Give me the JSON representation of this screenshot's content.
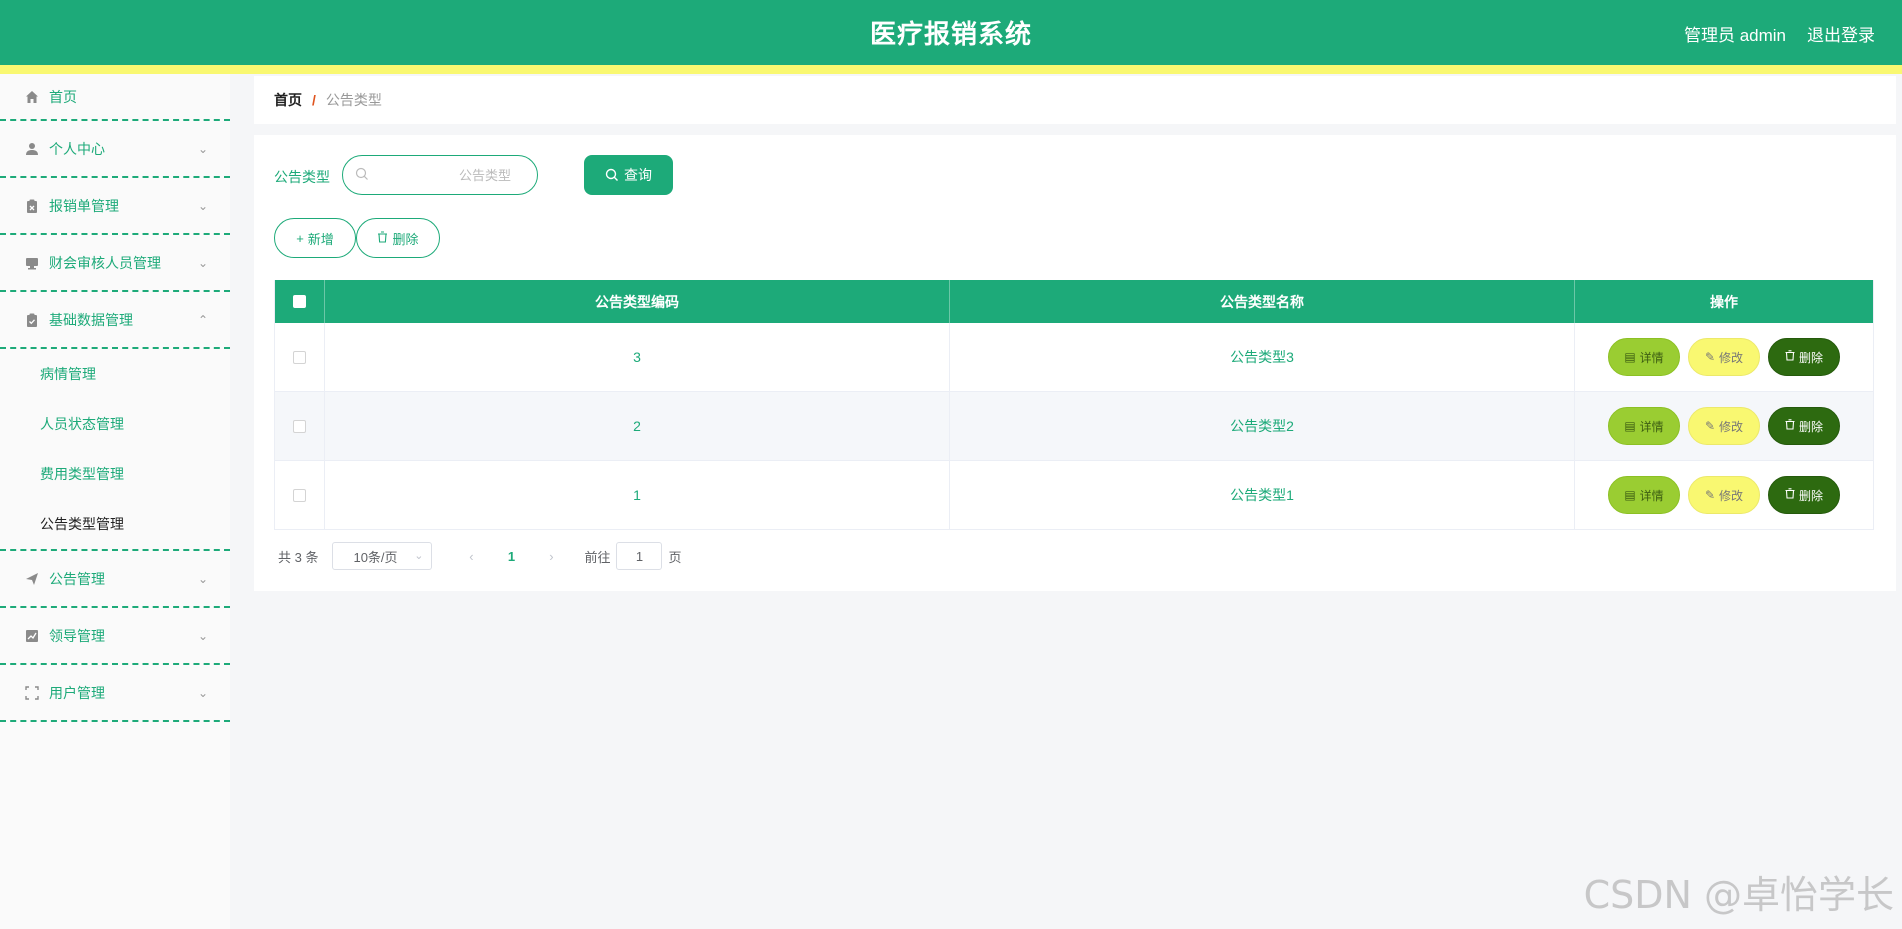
{
  "header": {
    "title": "医疗报销系统",
    "user": "管理员 admin",
    "logout": "退出登录"
  },
  "sidebar": {
    "items": [
      {
        "label": "首页",
        "icon": "home-icon"
      },
      {
        "label": "个人中心",
        "icon": "user-icon"
      },
      {
        "label": "报销单管理",
        "icon": "clipboard-x-icon"
      },
      {
        "label": "财会审核人员管理",
        "icon": "monitor-icon"
      },
      {
        "label": "基础数据管理",
        "icon": "clipboard-check-icon"
      },
      {
        "label": "公告管理",
        "icon": "send-icon"
      },
      {
        "label": "领导管理",
        "icon": "chart-icon"
      },
      {
        "label": "用户管理",
        "icon": "scan-icon"
      }
    ],
    "submenu": [
      {
        "label": "病情管理"
      },
      {
        "label": "人员状态管理"
      },
      {
        "label": "费用类型管理"
      },
      {
        "label": "公告类型管理"
      }
    ]
  },
  "breadcrumb": {
    "home": "首页",
    "separator": "/",
    "current": "公告类型"
  },
  "search": {
    "label": "公告类型",
    "placeholder": "公告类型",
    "button": "查询"
  },
  "actions": {
    "add": "新增",
    "delete": "删除"
  },
  "table": {
    "columns": [
      "公告类型编码",
      "公告类型名称",
      "操作"
    ],
    "rows": [
      {
        "code": "3",
        "name": "公告类型3"
      },
      {
        "code": "2",
        "name": "公告类型2"
      },
      {
        "code": "1",
        "name": "公告类型1"
      }
    ],
    "ops": {
      "detail": "详情",
      "edit": "修改",
      "delete": "删除"
    }
  },
  "pagination": {
    "total": "共 3 条",
    "page_size": "10条/页",
    "current_page": "1",
    "goto_label": "前往",
    "goto_value": "1",
    "page_suffix": "页"
  },
  "watermark": "CSDN @卓怡学长",
  "colors": {
    "primary": "#1daa79",
    "accent_stripe": "#f9f871",
    "detail_button": "#9acd32",
    "edit_button": "#f9f871",
    "delete_button": "#2d6a10"
  }
}
